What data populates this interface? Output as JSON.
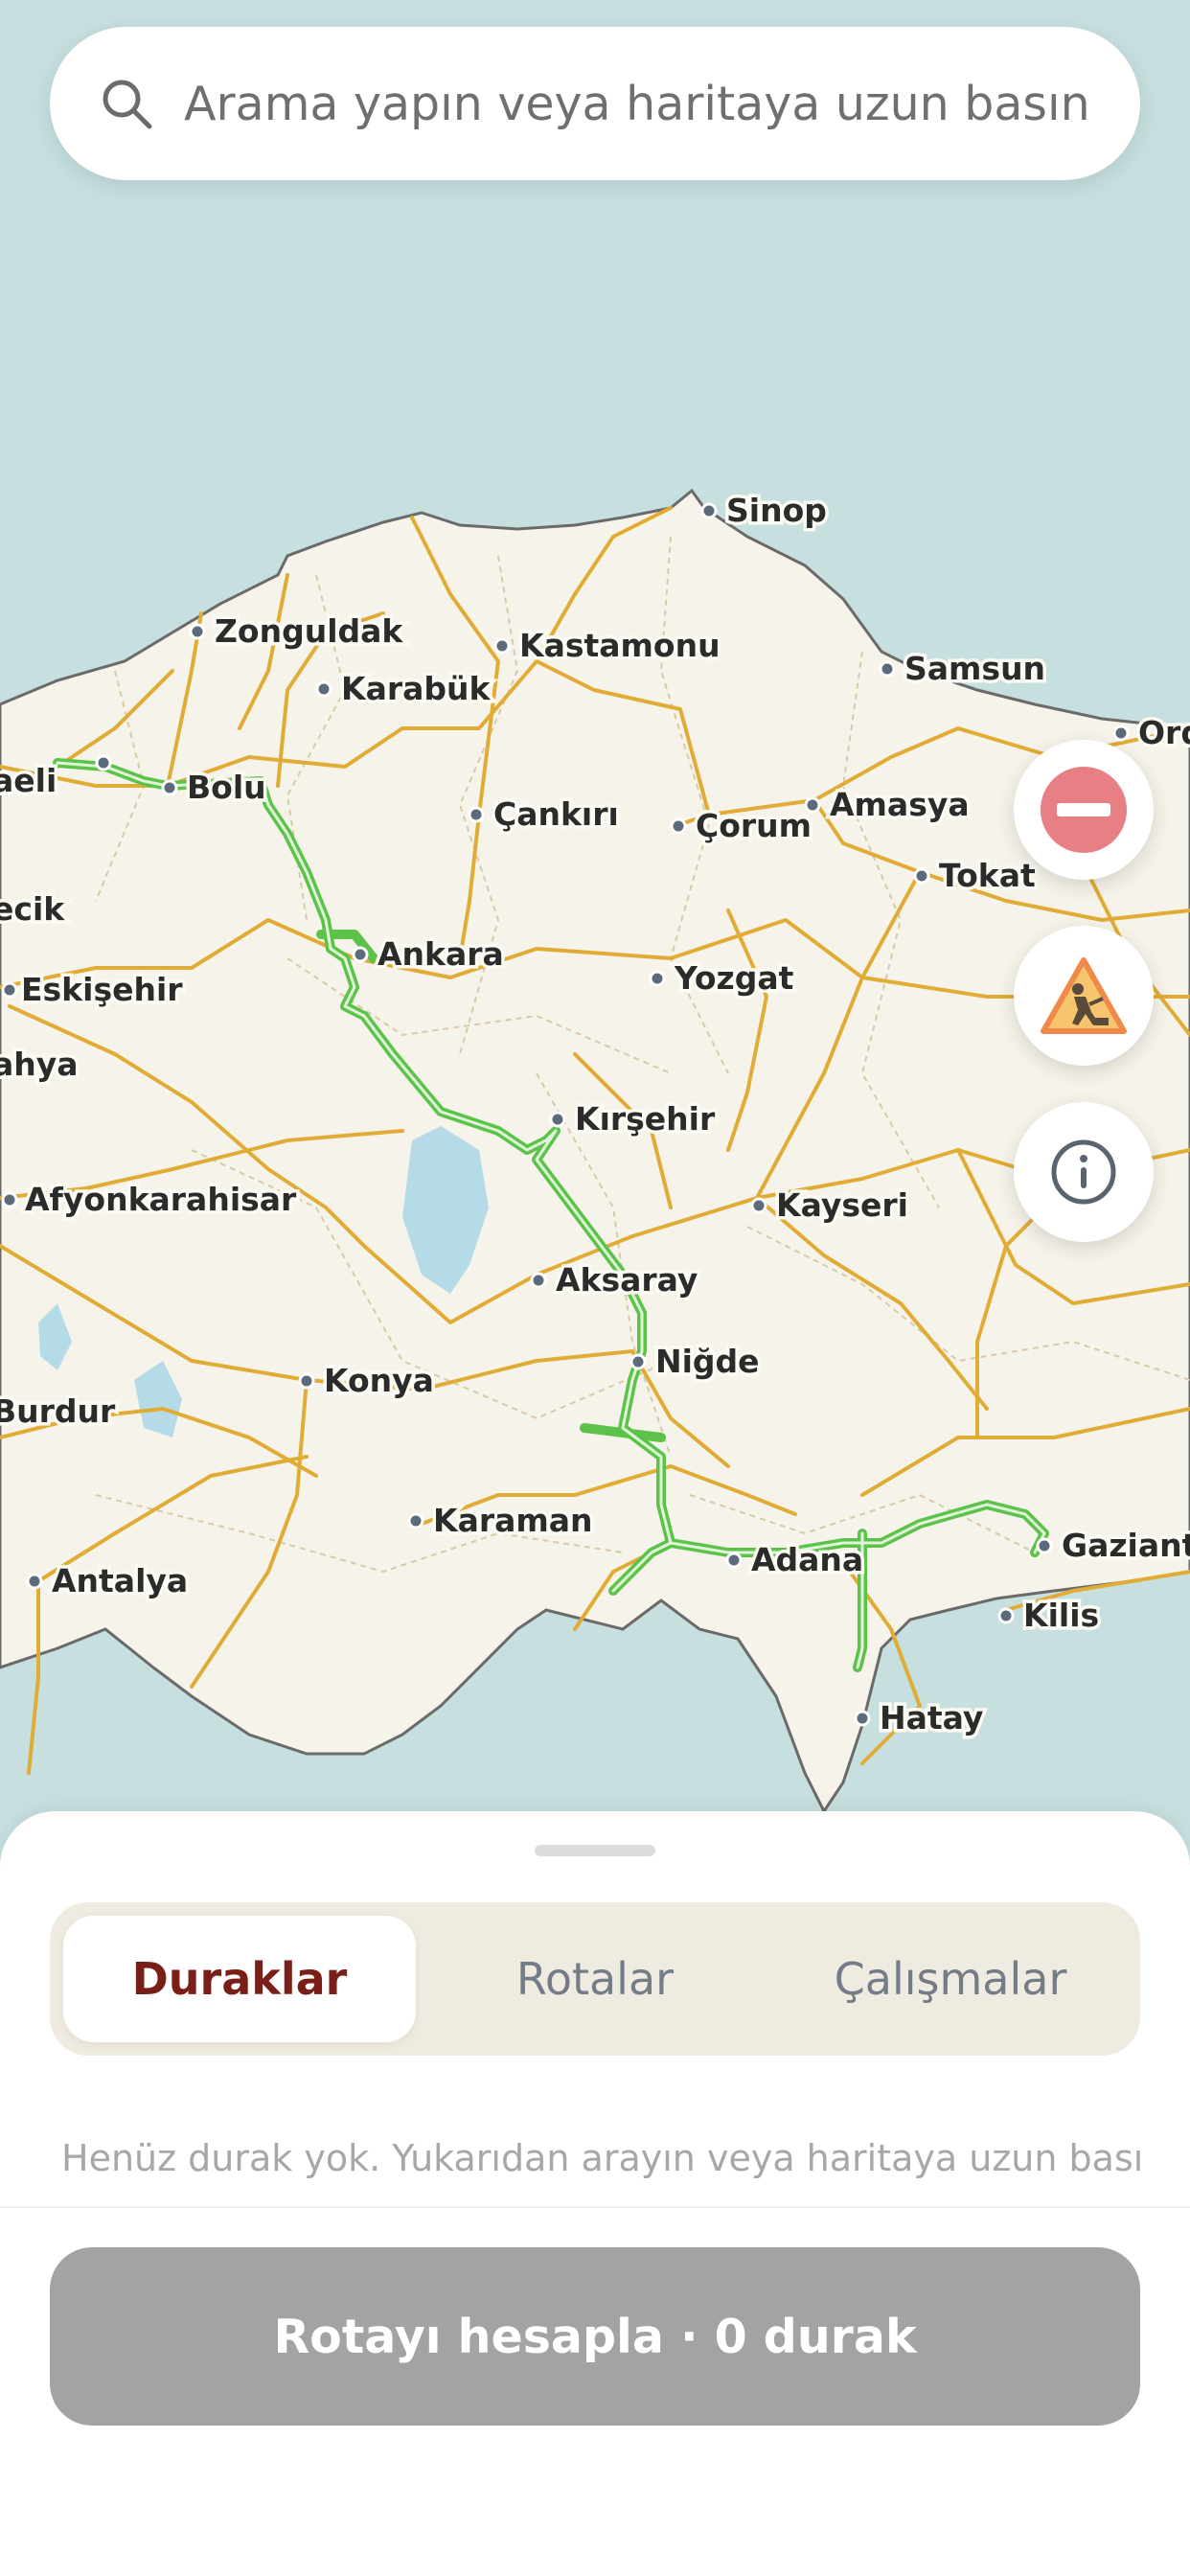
{
  "search": {
    "placeholder": "Arama yapın veya haritaya uzun basın"
  },
  "map": {
    "cities": [
      "Sinop",
      "Zonguldak",
      "Kastamonu",
      "Karabük",
      "Samsun",
      "Bolu",
      "aeli",
      "Çankırı",
      "Çorum",
      "Amasya",
      "Tokat",
      "Ankara",
      "ecik",
      "Eskişehir",
      "Yozgat",
      "ahya",
      "Kırşehir",
      "Afyonkarahisar",
      "Kayseri",
      "Aksaray",
      "Niğde",
      "Konya",
      "Burdur",
      "Karaman",
      "Adana",
      "Gaziante",
      "Kilis",
      "Antalya",
      "Hatay",
      "Ord"
    ],
    "colors": {
      "land": "#f6f4ea",
      "sea": "#c7dfdf",
      "road": "#e0ac36",
      "route": "#5cc24a",
      "lake": "#b6dbe8"
    }
  },
  "map_controls": [
    {
      "icon": "no-entry-icon",
      "color": "#e87f85"
    },
    {
      "icon": "road-work-icon",
      "color": "#f4a64f"
    },
    {
      "icon": "info-icon",
      "color": "#5a6470"
    }
  ],
  "tabs": [
    {
      "label": "Duraklar",
      "active": true
    },
    {
      "label": "Rotalar",
      "active": false
    },
    {
      "label": "Çalışmalar",
      "active": false
    }
  ],
  "stops": {
    "empty_message": "Henüz durak yok. Yukarıdan arayın veya haritaya uzun basın."
  },
  "footer": {
    "calculate_label": "Rotayı hesapla · 0 durak"
  }
}
